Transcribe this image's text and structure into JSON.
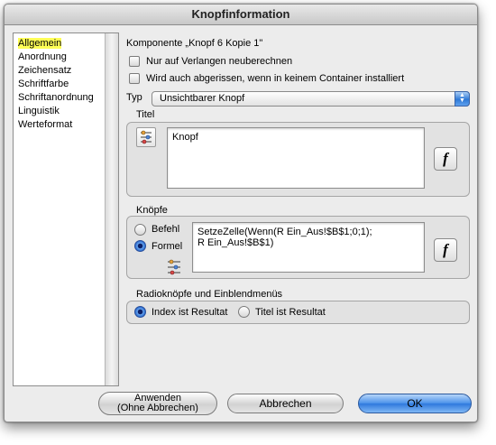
{
  "window": {
    "title": "Knopfinformation"
  },
  "sidebar": {
    "items": [
      {
        "label": "Allgemein",
        "selected": true
      },
      {
        "label": "Anordnung"
      },
      {
        "label": "Zeichensatz"
      },
      {
        "label": "Schriftfarbe"
      },
      {
        "label": "Schriftanordnung"
      },
      {
        "label": "Linguistik"
      },
      {
        "label": "Werteformat"
      }
    ]
  },
  "general": {
    "component_label": "Komponente „Knopf 6 Kopie 1\"",
    "checkbox_recalc": {
      "label": "Nur auf Verlangen neuberechnen",
      "checked": false
    },
    "checkbox_tearoff": {
      "label": "Wird auch abgerissen, wenn in keinem Container installiert",
      "checked": false
    },
    "type_label": "Typ",
    "type_value": "Unsichtbarer Knopf"
  },
  "title_section": {
    "heading": "Titel",
    "text": "Knopf",
    "function_button": "f"
  },
  "buttons_section": {
    "heading": "Knöpfe",
    "radio_command": {
      "label": "Befehl",
      "selected": false
    },
    "radio_formula": {
      "label": "Formel",
      "selected": true
    },
    "formula_text": "SetzeZelle(Wenn(R Ein_Aus!$B$1;0;1);\nR Ein_Aus!$B$1)",
    "function_button": "f"
  },
  "radio_section": {
    "heading": "Radioknöpfe und Einblendmenüs",
    "radio_index": {
      "label": "Index ist Resultat",
      "selected": true
    },
    "radio_title": {
      "label": "Titel ist Resultat",
      "selected": false
    }
  },
  "footer": {
    "apply_label_line1": "Anwenden",
    "apply_label_line2": "(Ohne Abbrechen)",
    "cancel_label": "Abbrechen",
    "ok_label": "OK"
  },
  "colors": {
    "selection_highlight": "#ffff56",
    "default_button": "#2f79dd"
  }
}
